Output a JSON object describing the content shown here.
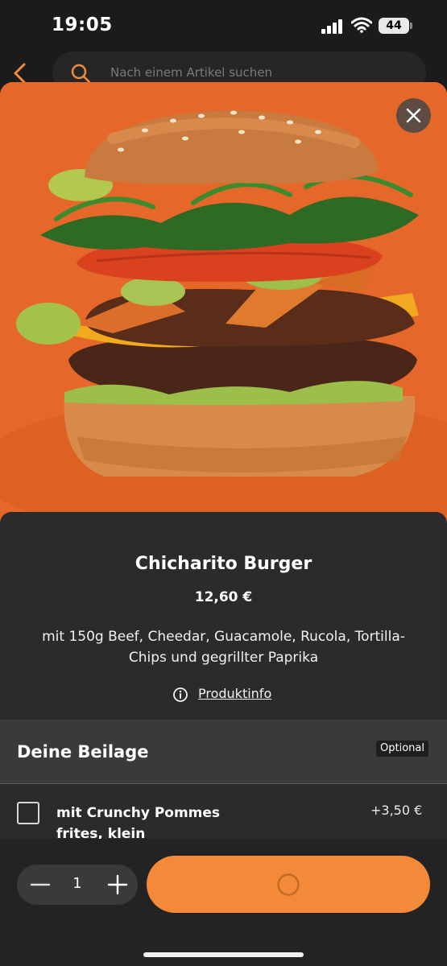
{
  "status_bar": {
    "time": "19:05",
    "battery": "44"
  },
  "nav": {
    "search_placeholder": "Nach einem Artikel suchen"
  },
  "product": {
    "title": "Chicharito Burger",
    "price": "12,60 €",
    "description": "mit 150g Beef, Cheedar, Guacamole, Rucola, Tortilla-Chips und gegrillter Paprika",
    "info_link": "Produktinfo"
  },
  "section": {
    "title": "Deine Beilage",
    "badge": "Optional"
  },
  "option": {
    "label": "mit Crunchy Pommes frites, klein",
    "price": "+3,50 €"
  },
  "cart": {
    "quantity": "1"
  },
  "colors": {
    "accent": "#f28a3a",
    "hero_bg": "#e5682a",
    "sheet_bg": "#2b2b2b",
    "section_bg": "#3a3a3a"
  }
}
